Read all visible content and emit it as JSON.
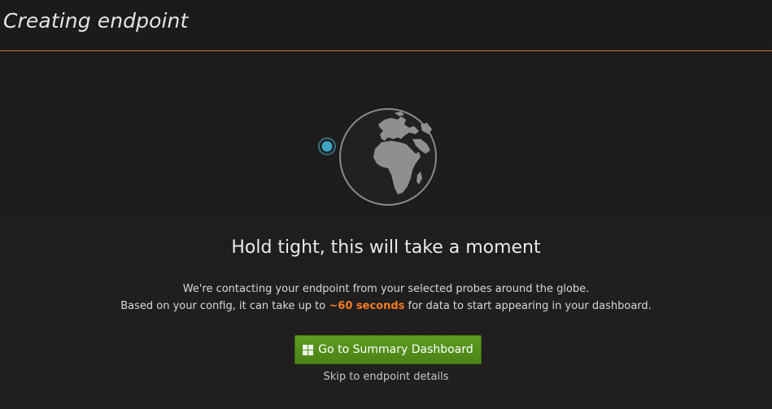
{
  "header": {
    "title": "Creating endpoint"
  },
  "main": {
    "heading": "Hold tight, this will take a moment",
    "description_line1": "We're contacting your endpoint from your selected probes around the globe.",
    "description_line2_prefix": "Based on your config, it can take up to ",
    "description_line2_highlight": "~60 seconds",
    "description_line2_suffix": " for data to start appearing in your dashboard.",
    "primary_button_label": "Go to Summary Dashboard",
    "primary_button_icon": "dashboard-grid-icon",
    "skip_link_label": "Skip to endpoint details"
  },
  "colors": {
    "accent_orange": "#f47b21",
    "button_green": "#5d9d1f",
    "probe_blue": "#3fa3c4",
    "header_rule": "#c6762f"
  }
}
